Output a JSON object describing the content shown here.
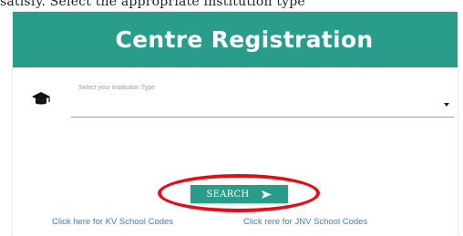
{
  "top_text": "satisfy. Select the appropriate institution type",
  "header": {
    "title": "Centre Registration",
    "background_color": "#2a9d8a"
  },
  "form": {
    "institution_select": {
      "label": "Select your Institution Type",
      "value": "",
      "icon": "graduation-cap-icon"
    }
  },
  "search_button": {
    "label": "SEARCH",
    "icon": "send-arrow-icon",
    "color": "#2a9d8a"
  },
  "annotation": {
    "highlight_color": "#e0101a"
  },
  "links": {
    "kv_codes": "Click here for KV School Codes",
    "jnv_codes": "Click rere for JNV School Codes"
  }
}
